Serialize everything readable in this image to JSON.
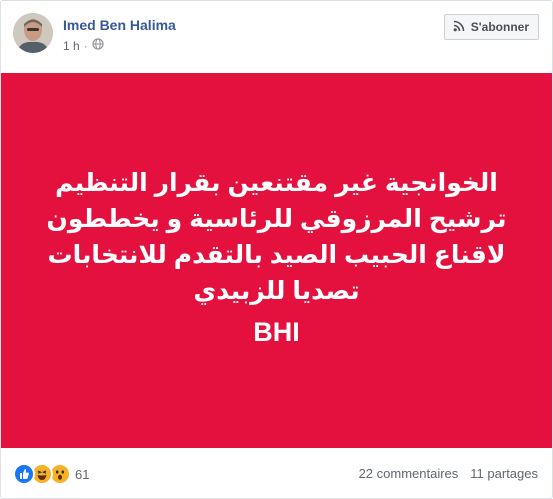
{
  "post": {
    "author": "Imed Ben Halima",
    "time": "1 h",
    "dot": "·",
    "subscribe_label": "S'abonner"
  },
  "banner": {
    "text": "الخوانجية غير مقتنعين بقرار التنظيم ترشيح المرزوقي للرئاسية و يخططون لاقناع الحبيب الصيد بالتقدم للانتخابات تصديا للزبيدي",
    "signature": "BHI",
    "background_color": "#e4113e"
  },
  "footer": {
    "reactions": [
      "like-icon",
      "haha-icon",
      "wow-icon"
    ],
    "reaction_count": "61",
    "comments": "22 commentaires",
    "shares": "11 partages"
  },
  "colors": {
    "author_link": "#385898",
    "meta_text": "#616770"
  },
  "icons": {
    "audience": "globe-icon",
    "subscribe": "rss-icon"
  }
}
